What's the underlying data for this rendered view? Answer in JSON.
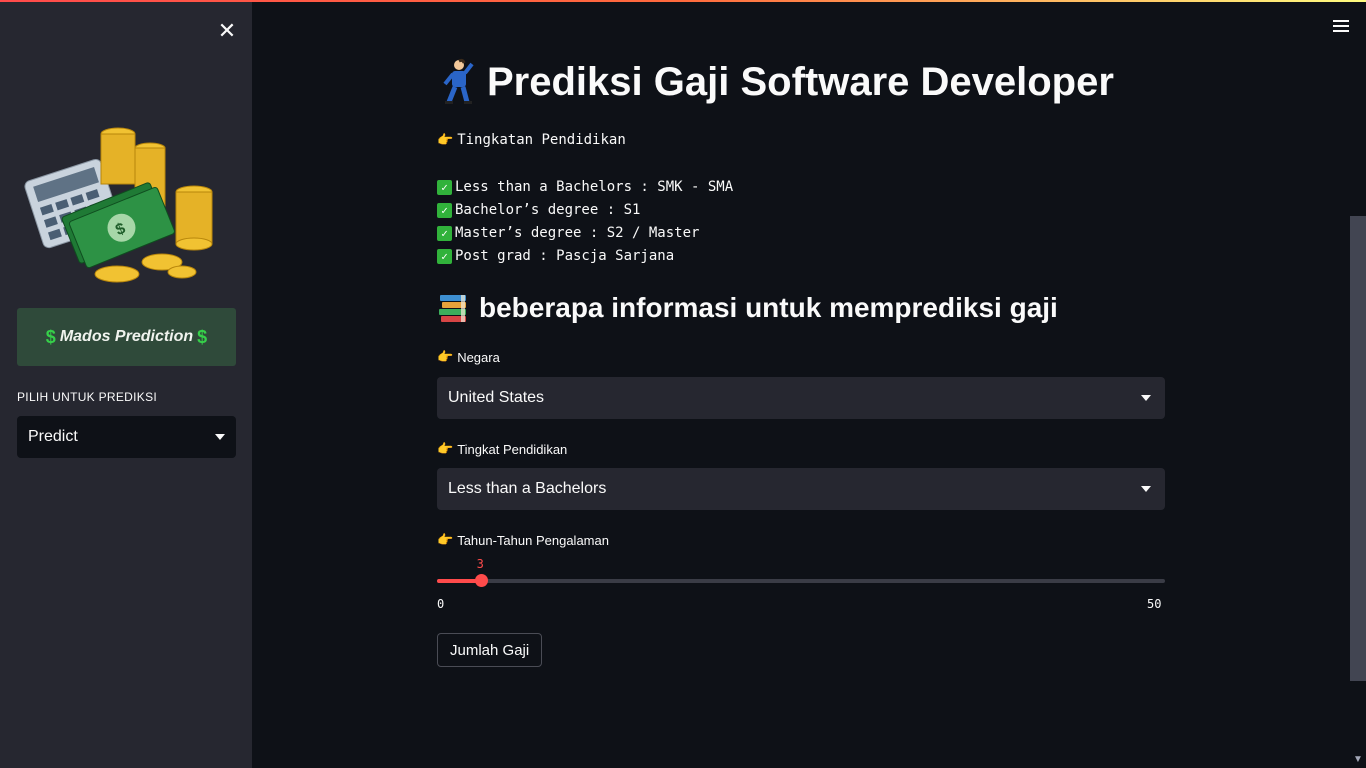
{
  "sidebar": {
    "brand_label": "Mados Prediction",
    "brand_dollar": "$",
    "select_label": "PILIH UNTUK PREDIKSI",
    "select_value": "Predict"
  },
  "main": {
    "title": "Prediksi Gaji Software Developer",
    "education_header": "Tingkatan Pendidikan",
    "education_items": [
      "Less than a Bachelors : SMK - SMA",
      "Bachelor’s degree : S1",
      "Master’s degree : S2 / Master",
      "Post grad : Pascja Sarjana"
    ],
    "subtitle": "beberapa informasi untuk memprediksi gaji",
    "country_label": "Negara",
    "country_value": "United States",
    "education_label": "Tingkat Pendidikan",
    "education_value": "Less than a Bachelors",
    "experience_label": "Tahun-Tahun Pengalaman",
    "experience_value": 3,
    "experience_min": 0,
    "experience_max": 50,
    "submit_label": "Jumlah Gaji"
  },
  "colors": {
    "accent": "#ff4b4b",
    "sidebar_bg": "#262730",
    "main_bg": "#0e1117",
    "brand_bg": "#2f4a3a"
  },
  "icons": [
    "close-icon",
    "menu-icon",
    "pointing-hand-icon",
    "check-icon",
    "books-icon",
    "dancing-person-icon",
    "money-illustration"
  ]
}
